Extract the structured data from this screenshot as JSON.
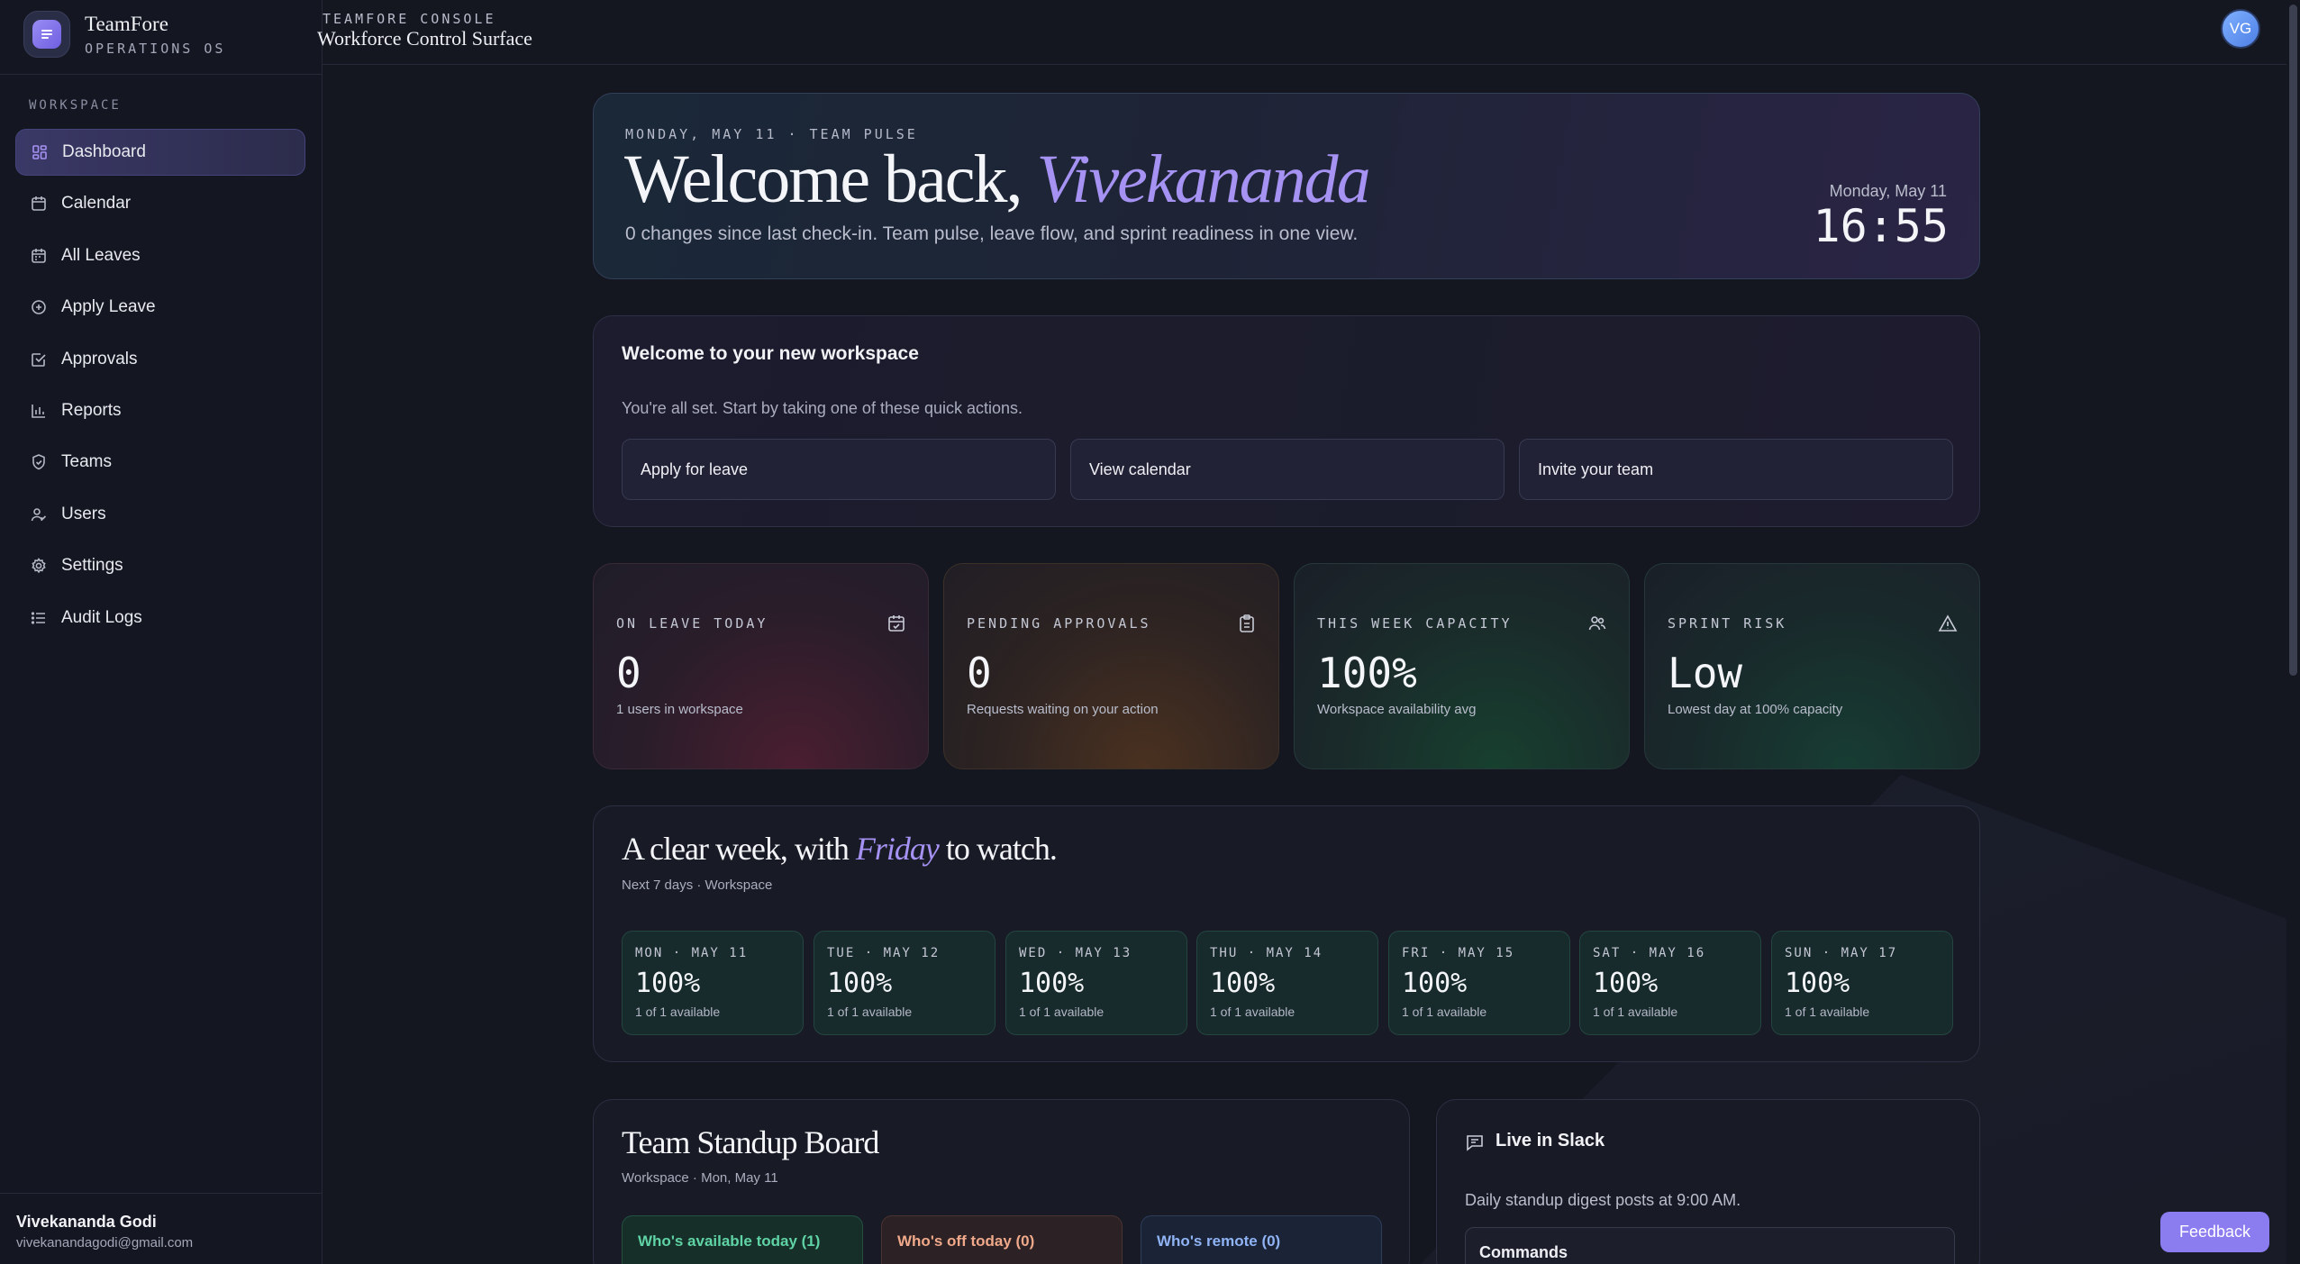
{
  "brand": {
    "name": "TeamFore",
    "subtitle": "OPERATIONS OS"
  },
  "sidebar": {
    "section_label": "WORKSPACE",
    "items": [
      {
        "label": "Dashboard",
        "icon": "dashboard-icon"
      },
      {
        "label": "Calendar",
        "icon": "calendar-icon"
      },
      {
        "label": "All Leaves",
        "icon": "calendar-list-icon"
      },
      {
        "label": "Apply Leave",
        "icon": "plus-circle-icon"
      },
      {
        "label": "Approvals",
        "icon": "check-square-icon"
      },
      {
        "label": "Reports",
        "icon": "bar-chart-icon"
      },
      {
        "label": "Teams",
        "icon": "shield-icon"
      },
      {
        "label": "Users",
        "icon": "users-icon"
      },
      {
        "label": "Settings",
        "icon": "gear-icon"
      },
      {
        "label": "Audit Logs",
        "icon": "list-icon"
      }
    ],
    "user": {
      "name": "Vivekananda Godi",
      "email": "vivekanandagodi@gmail.com"
    }
  },
  "topbar": {
    "label": "TEAMFORE CONSOLE",
    "title": "Workforce Control Surface",
    "avatar_initials": "VG"
  },
  "hero": {
    "kicker": "MONDAY, MAY 11 · TEAM PULSE",
    "title_prefix": "Welcome back,",
    "title_name": "Vivekananda",
    "subtitle": "0 changes since last check-in. Team pulse, leave flow, and sprint readiness in one view.",
    "date": "Monday, May 11",
    "time": "16:55"
  },
  "welcome": {
    "title": "Welcome to your new workspace",
    "subtitle": "You're all set. Start by taking one of these quick actions.",
    "actions": [
      "Apply for leave",
      "View calendar",
      "Invite your team"
    ]
  },
  "stats": [
    {
      "label": "ON LEAVE TODAY",
      "value": "0",
      "sub": "1 users in workspace",
      "icon": "calendar-check-icon",
      "color": "#4a1e30"
    },
    {
      "label": "PENDING APPROVALS",
      "value": "0",
      "sub": "Requests waiting on your action",
      "icon": "clipboard-icon",
      "color": "#4a3120"
    },
    {
      "label": "THIS WEEK CAPACITY",
      "value": "100%",
      "sub": "Workspace availability avg",
      "icon": "users-icon",
      "color": "#17402f"
    },
    {
      "label": "SPRINT RISK",
      "value": "Low",
      "sub": "Lowest day at 100% capacity",
      "icon": "warning-icon",
      "color": "#173d33"
    }
  ],
  "week": {
    "title_prefix": "A clear week, with",
    "title_day": "Friday",
    "title_suffix": "to watch.",
    "subtitle": "Next 7 days · Workspace",
    "days": [
      {
        "label": "MON · MAY 11",
        "pct": "100%",
        "sub": "1 of 1 available"
      },
      {
        "label": "TUE · MAY 12",
        "pct": "100%",
        "sub": "1 of 1 available"
      },
      {
        "label": "WED · MAY 13",
        "pct": "100%",
        "sub": "1 of 1 available"
      },
      {
        "label": "THU · MAY 14",
        "pct": "100%",
        "sub": "1 of 1 available"
      },
      {
        "label": "FRI · MAY 15",
        "pct": "100%",
        "sub": "1 of 1 available"
      },
      {
        "label": "SAT · MAY 16",
        "pct": "100%",
        "sub": "1 of 1 available"
      },
      {
        "label": "SUN · MAY 17",
        "pct": "100%",
        "sub": "1 of 1 available"
      }
    ]
  },
  "standup": {
    "title": "Team Standup Board",
    "subtitle": "Workspace · Mon, May 11",
    "pills": [
      {
        "label": "Who's available today (1)",
        "color": "#5fd3a5"
      },
      {
        "label": "Who's off today (0)",
        "color": "#f0a98a"
      },
      {
        "label": "Who's remote (0)",
        "color": "#8fb3f5"
      }
    ]
  },
  "slack": {
    "title": "Live in Slack",
    "subtitle": "Daily standup digest posts at 9:00 AM.",
    "commands_label": "Commands"
  },
  "feedback_label": "Feedback"
}
